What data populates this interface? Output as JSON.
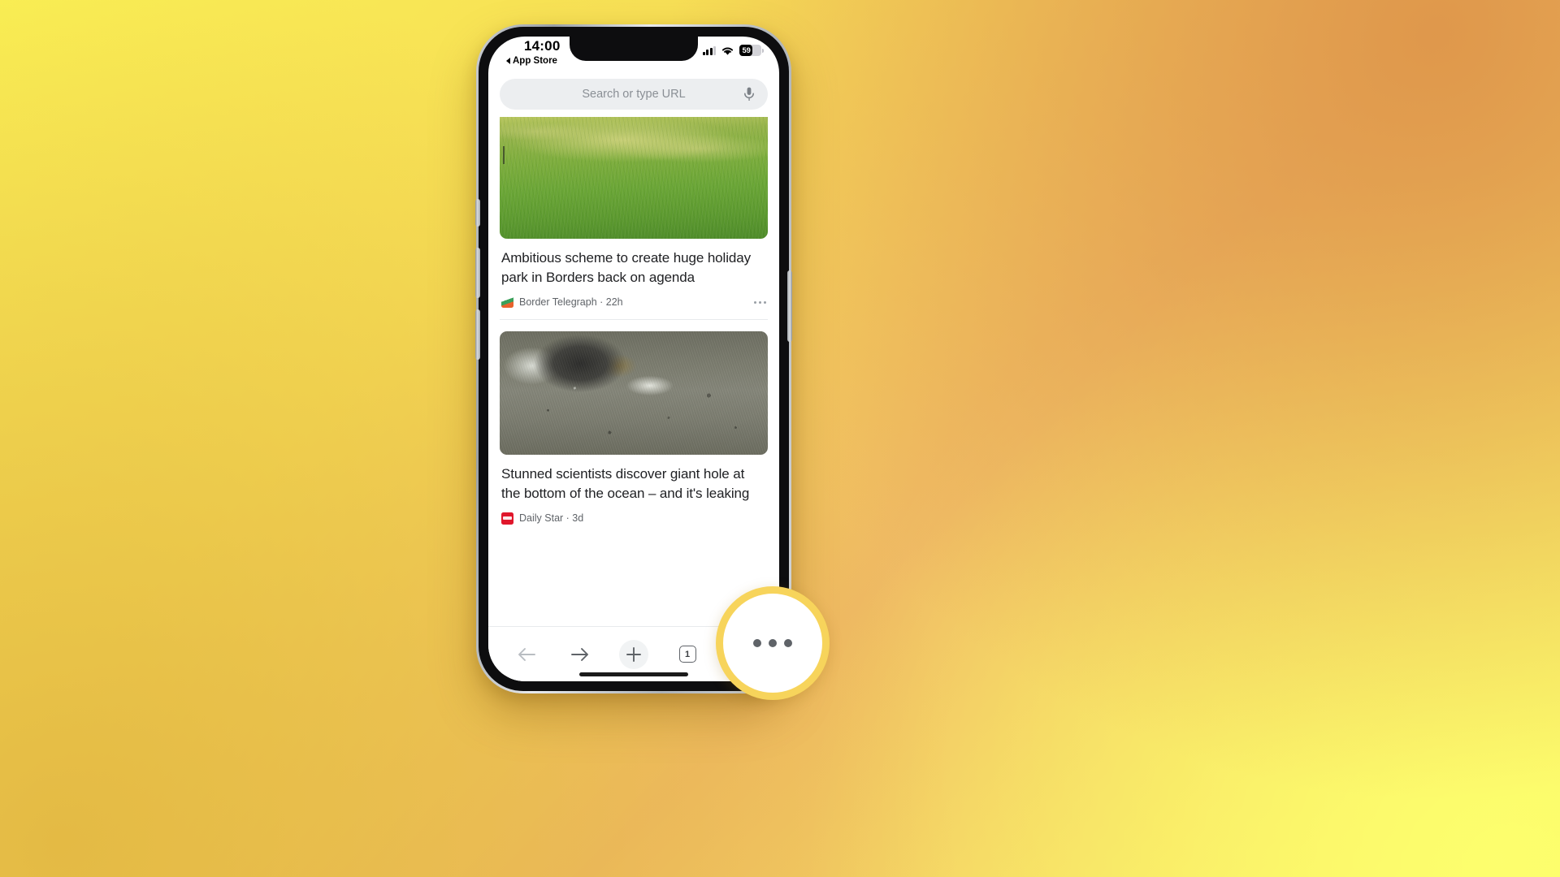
{
  "background": {
    "gradient_from": "#FAF054",
    "gradient_mid": "#DE964A",
    "gradient_to": "#FDFF6E"
  },
  "status_bar": {
    "time": "14:00",
    "back_app_label": "App Store",
    "back_icon": "back-triangle-icon",
    "signal_icon": "cellular-signal-icon",
    "wifi_icon": "wifi-icon",
    "battery_percent": "59",
    "battery_fill_ratio": 0.59
  },
  "omnibox": {
    "placeholder": "Search or type URL",
    "value": "",
    "mic_icon": "microphone-icon"
  },
  "feed": {
    "articles": [
      {
        "image_name": "grass-field-photo",
        "headline": "Ambitious scheme to create huge holiday park in Borders back on agenda",
        "source": "Border Telegraph",
        "time_ago": "22h",
        "byline": "Border Telegraph · 22h",
        "favicon_name": "border-telegraph-favicon",
        "menu_icon": "more-options-icon"
      },
      {
        "image_name": "ocean-seafloor-hole-photo",
        "headline": "Stunned scientists discover giant hole at the bottom of the ocean – and it's leaking",
        "source": "Daily Star",
        "time_ago": "3d",
        "byline": "Daily Star · 3d",
        "favicon_name": "daily-star-favicon",
        "menu_icon": "more-options-icon"
      }
    ]
  },
  "toolbar": {
    "back_icon": "arrow-left-icon",
    "forward_icon": "arrow-right-icon",
    "new_tab_icon": "plus-icon",
    "tab_count": "1",
    "menu_icon": "three-dots-menu-icon"
  },
  "highlight": {
    "target": "three-dots-menu-icon",
    "ring_color": "#F7D45B",
    "fill_color": "#FFFFFF"
  }
}
